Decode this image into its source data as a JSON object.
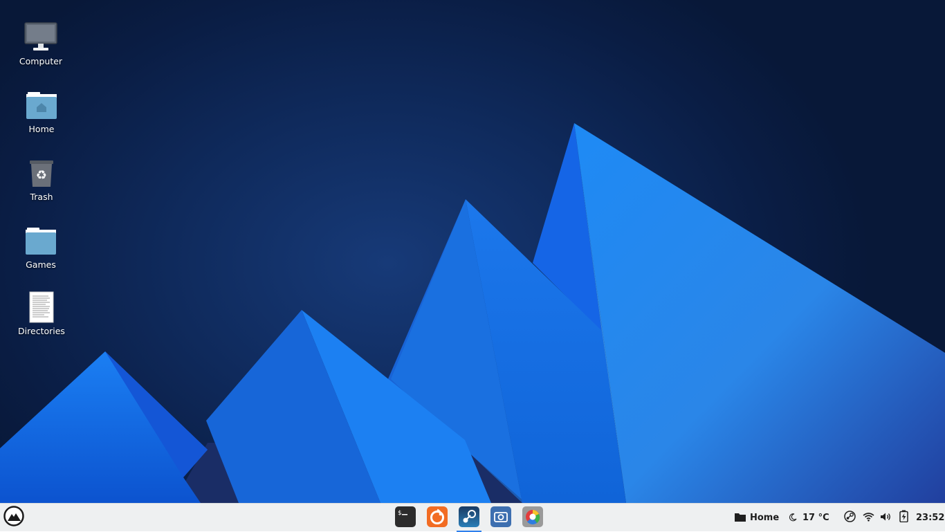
{
  "desktop": {
    "icons": [
      {
        "label": "Computer",
        "icon": "computer-icon"
      },
      {
        "label": "Home",
        "icon": "home-folder-icon"
      },
      {
        "label": "Trash",
        "icon": "trash-icon"
      },
      {
        "label": "Games",
        "icon": "folder-icon"
      },
      {
        "label": "Directories",
        "icon": "text-document-icon"
      }
    ]
  },
  "taskbar": {
    "start_icon": "mountain-logo-icon",
    "dock": [
      {
        "app": "Terminal",
        "icon": "terminal-icon"
      },
      {
        "app": "Firefox",
        "icon": "firefox-icon"
      },
      {
        "app": "Steam",
        "icon": "steam-icon",
        "active": true
      },
      {
        "app": "Screenshot",
        "icon": "camera-icon"
      },
      {
        "app": "Color picker",
        "icon": "color-wheel-icon"
      }
    ],
    "tray": {
      "places_label": "Home",
      "weather_text": "17 °C",
      "clock": "23:52",
      "icons": [
        "folder-icon",
        "moon-icon",
        "steam-tray-icon",
        "wifi-icon",
        "volume-icon",
        "battery-icon"
      ]
    }
  },
  "colors": {
    "wallpaper_bg": "#0f2a5c",
    "accent_blue": "#1f7cf2",
    "taskbar_bg": "#eef0f1",
    "folder_blue": "#6aa9cf"
  }
}
